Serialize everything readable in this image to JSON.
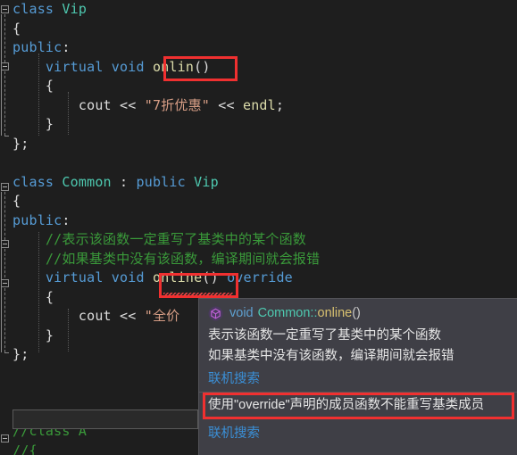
{
  "app": {
    "kind": "code-editor",
    "language": "C++",
    "theme_background": "#1e1e1e"
  },
  "colors": {
    "background": "#1e1e1e",
    "keyword": "#569cd6",
    "type": "#4ec9b0",
    "function": "#dcdcaa",
    "string": "#d69d85",
    "comment": "#3a9a3a",
    "plain": "#dcdcdc",
    "annotation_red": "#f03030",
    "tooltip_background": "#3f3f46",
    "tooltip_link": "#3b8fd6",
    "squiggle": "#f04747"
  },
  "code": {
    "lines": [
      {
        "tokens": [
          {
            "t": "class",
            "c": "kw"
          },
          {
            "t": " ",
            "c": "plain"
          },
          {
            "t": "Vip",
            "c": "type"
          }
        ]
      },
      {
        "tokens": [
          {
            "t": "{",
            "c": "plain"
          }
        ]
      },
      {
        "tokens": [
          {
            "t": "public",
            "c": "kw"
          },
          {
            "t": ":",
            "c": "plain"
          }
        ]
      },
      {
        "tokens": [
          {
            "t": "    ",
            "c": "plain"
          },
          {
            "t": "virtual",
            "c": "kw"
          },
          {
            "t": " ",
            "c": "plain"
          },
          {
            "t": "void",
            "c": "kw"
          },
          {
            "t": " ",
            "c": "plain"
          },
          {
            "t": "onlin",
            "c": "fn"
          },
          {
            "t": "()",
            "c": "plain"
          }
        ]
      },
      {
        "tokens": [
          {
            "t": "    {",
            "c": "plain"
          }
        ]
      },
      {
        "tokens": [
          {
            "t": "        ",
            "c": "plain"
          },
          {
            "t": "cout",
            "c": "plain"
          },
          {
            "t": " << ",
            "c": "plain"
          },
          {
            "t": "\"7折优惠\"",
            "c": "str"
          },
          {
            "t": " << ",
            "c": "plain"
          },
          {
            "t": "endl",
            "c": "fn"
          },
          {
            "t": ";",
            "c": "plain"
          }
        ]
      },
      {
        "tokens": [
          {
            "t": "    }",
            "c": "plain"
          }
        ]
      },
      {
        "tokens": [
          {
            "t": "};",
            "c": "plain"
          }
        ]
      },
      {
        "tokens": []
      },
      {
        "tokens": [
          {
            "t": "class",
            "c": "kw"
          },
          {
            "t": " ",
            "c": "plain"
          },
          {
            "t": "Common",
            "c": "type"
          },
          {
            "t": " : ",
            "c": "plain"
          },
          {
            "t": "public",
            "c": "kw"
          },
          {
            "t": " ",
            "c": "plain"
          },
          {
            "t": "Vip",
            "c": "type"
          }
        ]
      },
      {
        "tokens": [
          {
            "t": "{",
            "c": "plain"
          }
        ]
      },
      {
        "tokens": [
          {
            "t": "public",
            "c": "kw"
          },
          {
            "t": ":",
            "c": "plain"
          }
        ]
      },
      {
        "tokens": [
          {
            "t": "    ",
            "c": "plain"
          },
          {
            "t": "//表示该函数一定重写了基类中的某个函数",
            "c": "cmt"
          }
        ]
      },
      {
        "tokens": [
          {
            "t": "    ",
            "c": "plain"
          },
          {
            "t": "//如果基类中没有该函数，编译期间就会报错",
            "c": "cmt"
          }
        ]
      },
      {
        "tokens": [
          {
            "t": "    ",
            "c": "plain"
          },
          {
            "t": "virtual",
            "c": "kw"
          },
          {
            "t": " ",
            "c": "plain"
          },
          {
            "t": "void",
            "c": "kw"
          },
          {
            "t": " ",
            "c": "plain"
          },
          {
            "t": "online",
            "c": "fn"
          },
          {
            "t": "()",
            "c": "plain"
          },
          {
            "t": " ",
            "c": "plain"
          },
          {
            "t": "override",
            "c": "kw"
          }
        ]
      },
      {
        "tokens": [
          {
            "t": "    {",
            "c": "plain"
          }
        ]
      },
      {
        "tokens": [
          {
            "t": "        ",
            "c": "plain"
          },
          {
            "t": "cout",
            "c": "plain"
          },
          {
            "t": " << ",
            "c": "plain"
          },
          {
            "t": "\"全价",
            "c": "str"
          }
        ]
      },
      {
        "tokens": [
          {
            "t": "    }",
            "c": "plain"
          }
        ]
      },
      {
        "tokens": [
          {
            "t": "};",
            "c": "plain"
          }
        ]
      },
      {
        "tokens": []
      },
      {
        "tokens": []
      },
      {
        "tokens": []
      },
      {
        "tokens": [
          {
            "t": "//class A",
            "c": "cmt"
          }
        ]
      },
      {
        "tokens": [
          {
            "t": "//{",
            "c": "cmt"
          }
        ]
      }
    ]
  },
  "annotations": {
    "box1_target": "onlin()",
    "box2_target": "online()",
    "box3_target": "使用\"override\"声明的成员函数不能重写基类成员"
  },
  "tooltip": {
    "icon": "method-cube-icon",
    "signature": {
      "return_type": "void",
      "scope": "Common::",
      "name": "online",
      "parens": "()"
    },
    "description_lines": [
      "表示该函数一定重写了基类中的某个函数",
      "如果基类中没有该函数，编译期间就会报错"
    ],
    "link_label_1": "联机搜索",
    "error_text": "使用\"override\"声明的成员函数不能重写基类成员",
    "link_label_2": "联机搜索"
  }
}
